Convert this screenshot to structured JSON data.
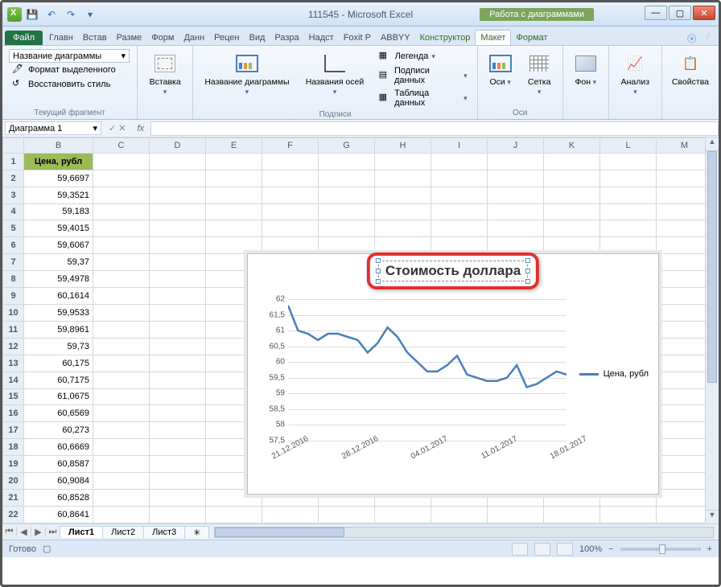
{
  "window": {
    "title": "111545 - Microsoft Excel",
    "chart_tools_label": "Работа с диаграммами"
  },
  "ribbon_tabs": {
    "file": "Файл",
    "tabs": [
      "Главн",
      "Встав",
      "Разме",
      "Форм",
      "Данн",
      "Рецен",
      "Вид",
      "Разра",
      "Надст",
      "Foxit P",
      "ABBYY"
    ],
    "context_tabs": [
      "Конструктор",
      "Макет",
      "Формат"
    ],
    "active": "Макет"
  },
  "ribbon": {
    "selection": {
      "value": "Название диаграммы",
      "format_sel": "Формат выделенного",
      "reset": "Восстановить стиль",
      "group": "Текущий фрагмент"
    },
    "insert": {
      "label": "Вставка"
    },
    "labels": {
      "chart_title": "Название диаграммы",
      "axis_titles": "Названия осей",
      "legend": "Легенда",
      "data_labels": "Подписи данных",
      "data_table": "Таблица данных",
      "group": "Подписи"
    },
    "axes": {
      "axes": "Оси",
      "grid": "Сетка",
      "group": "Оси"
    },
    "background": {
      "bg": "Фон"
    },
    "analysis": {
      "label": "Анализ"
    },
    "props": {
      "label": "Свойства"
    }
  },
  "formula": {
    "namebox": "Диаграмма 1",
    "fx": "fx"
  },
  "columns": [
    "B",
    "C",
    "D",
    "E",
    "F",
    "G",
    "H",
    "I",
    "J",
    "K",
    "L",
    "M"
  ],
  "header_cell": "Цена, рубл",
  "rows": [
    "59,6697",
    "59,3521",
    "59,183",
    "59,4015",
    "59,6067",
    "59,37",
    "59,4978",
    "60,1614",
    "59,9533",
    "59,8961",
    "59,73",
    "60,175",
    "60,7175",
    "61,0675",
    "60,6569",
    "60,273",
    "60,6669",
    "60,8587",
    "60,9084",
    "60,8528",
    "60,8641"
  ],
  "chart_data": {
    "type": "line",
    "title": "Стоимость доллара",
    "series": [
      {
        "name": "Цена, рубл"
      }
    ],
    "x_ticks": [
      "21.12.2016",
      "28.12.2016",
      "04.01.2017",
      "11.01.2017",
      "18.01.2017"
    ],
    "y_ticks": [
      "57,5",
      "58",
      "58,5",
      "59",
      "59,5",
      "60",
      "60,5",
      "61",
      "61,5",
      "62"
    ],
    "ylim": [
      57.5,
      62
    ],
    "values": [
      61.8,
      61.0,
      60.9,
      60.7,
      60.9,
      60.9,
      60.8,
      60.7,
      60.3,
      60.6,
      61.1,
      60.8,
      60.3,
      60.0,
      59.7,
      59.7,
      59.9,
      60.2,
      59.6,
      59.5,
      59.4,
      59.4,
      59.5,
      59.9,
      59.2,
      59.3,
      59.5,
      59.7,
      59.6
    ]
  },
  "sheet_tabs": {
    "tabs": [
      "Лист1",
      "Лист2",
      "Лист3"
    ],
    "active": "Лист1"
  },
  "status": {
    "ready": "Готово",
    "zoom": "100%"
  }
}
